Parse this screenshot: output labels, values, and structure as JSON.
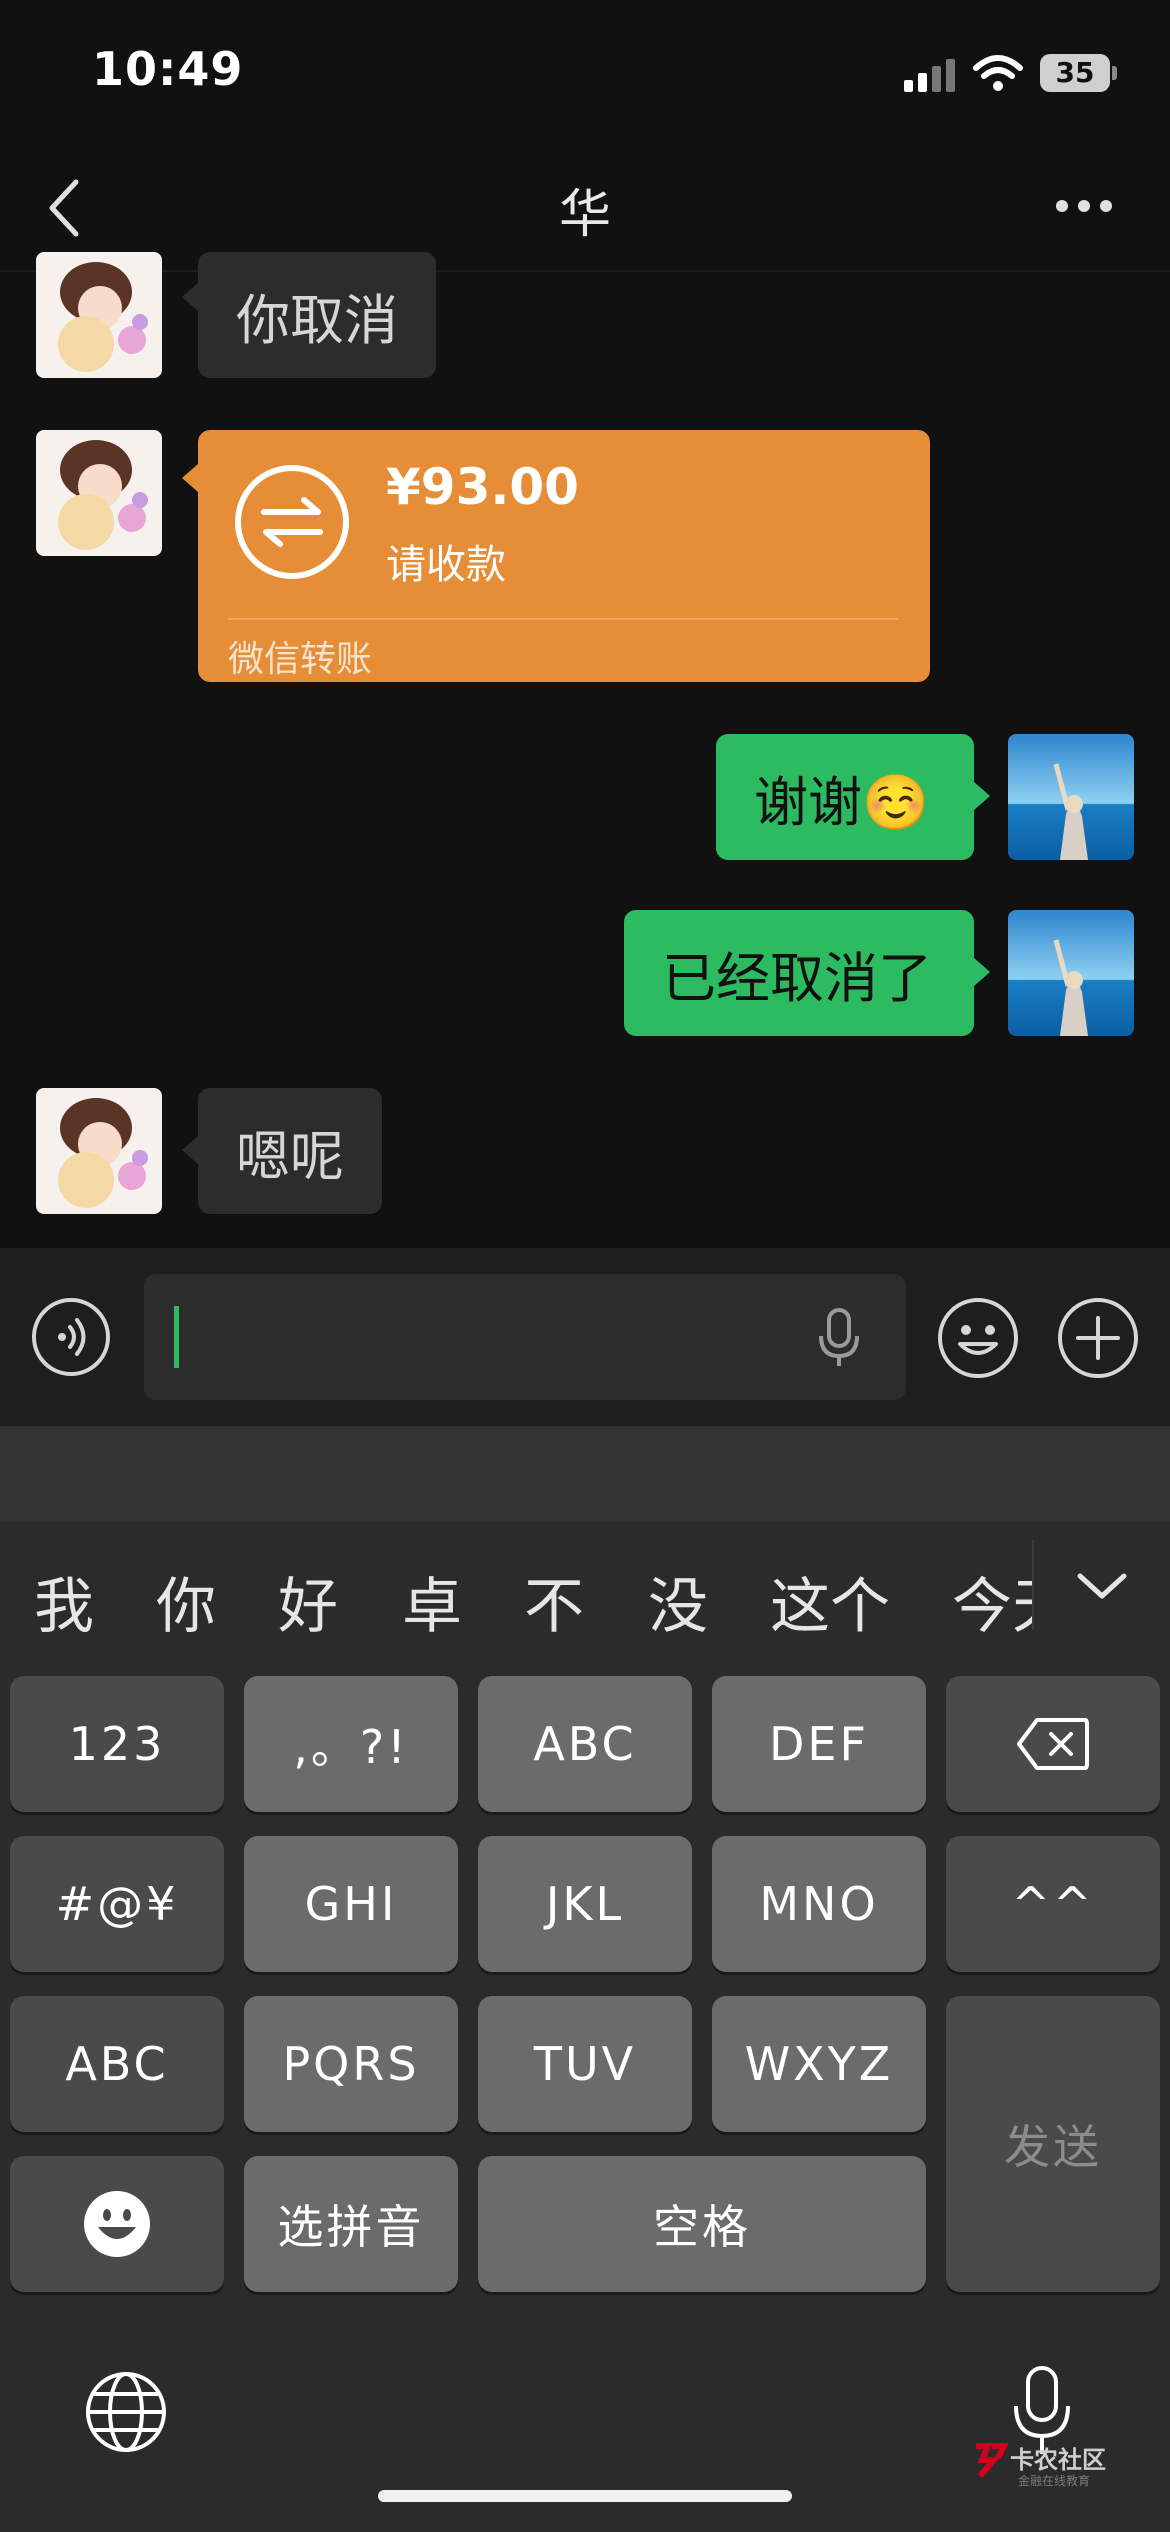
{
  "status_bar": {
    "time": "10:49",
    "battery": "35"
  },
  "nav": {
    "title": "华"
  },
  "messages": [
    {
      "side": "left",
      "text": "你取消"
    },
    {
      "side": "left",
      "type": "transfer",
      "amount": "¥93.00",
      "status": "请收款",
      "label": "微信转账"
    },
    {
      "side": "right",
      "text": "谢谢☺️"
    },
    {
      "side": "right",
      "text": "已经取消了"
    },
    {
      "side": "left",
      "text": "嗯呢"
    }
  ],
  "input": {
    "value": ""
  },
  "keyboard": {
    "candidates": [
      "我",
      "你",
      "好",
      "卓",
      "不",
      "没",
      "这个",
      "今天"
    ],
    "rows": [
      [
        "123",
        ",。?!",
        "ABC",
        "DEF"
      ],
      [
        "#@¥",
        "GHI",
        "JKL",
        "MNO",
        "^^"
      ],
      [
        "ABC",
        "PQRS",
        "TUV",
        "WXYZ"
      ],
      [
        "选拼音",
        "空格"
      ]
    ],
    "send_label": "发送"
  },
  "watermark": {
    "text": "卡农社区",
    "sub": "金融在线教育"
  },
  "colors": {
    "sent_bubble": "#2dbb61",
    "transfer": "#e58e37",
    "background": "#111111"
  }
}
